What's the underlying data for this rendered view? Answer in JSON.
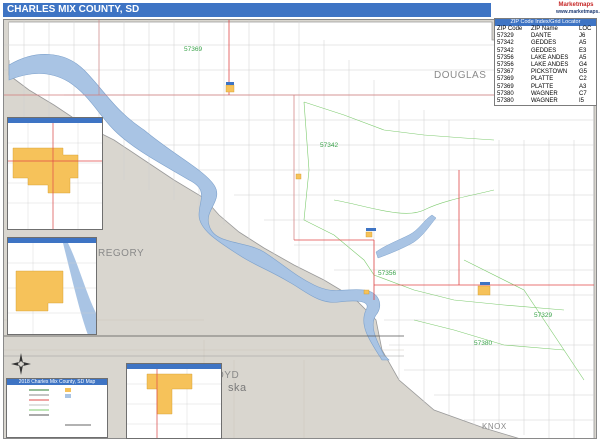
{
  "title": "CHARLES MIX COUNTY, SD",
  "brand": {
    "line1": "Marketmaps",
    "line2": "www.marketmaps.com"
  },
  "zip_table": {
    "title": "ZIP Code Index/Grid Locator",
    "headers": [
      "ZIP Code",
      "ZIP Name",
      "LOC"
    ],
    "rows": [
      [
        "57329",
        "DANTE",
        "J6"
      ],
      [
        "57342",
        "GEDDES",
        "A5"
      ],
      [
        "57342",
        "GEDDES",
        "E3"
      ],
      [
        "57356",
        "LAKE ANDES",
        "A5"
      ],
      [
        "57356",
        "LAKE ANDES",
        "G4"
      ],
      [
        "57367",
        "PICKSTOWN",
        "G5"
      ],
      [
        "57369",
        "PLATTE",
        "C2"
      ],
      [
        "57369",
        "PLATTE",
        "A3"
      ],
      [
        "57380",
        "WAGNER",
        "C7"
      ],
      [
        "57380",
        "WAGNER",
        "I5"
      ]
    ]
  },
  "map_labels": {
    "douglas": "DOUGLAS",
    "gregory": "REGORY",
    "boyd": "OYD",
    "knox": "KNOX",
    "nebraska": "ska"
  },
  "zip_labels": {
    "z1": "57369",
    "z2": "57342",
    "z3": "57356",
    "z4": "57329",
    "z5": "57380"
  },
  "legend": {
    "title": "2018 Charles Mix County, SD Map"
  },
  "colors": {
    "title_bar": "#3e74c4",
    "land": "#ffffff",
    "outside": "#d9d6cf",
    "water": "#a9c4e4",
    "zip_boundary": "#7ecb6f",
    "major_road": "#e04848",
    "city": "#f6c25a"
  }
}
